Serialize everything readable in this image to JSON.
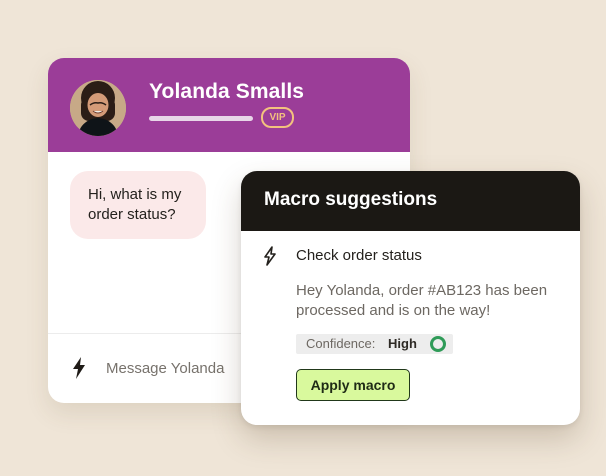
{
  "colors": {
    "background": "#efe5d7",
    "chat_header": "#9b3d98",
    "macro_header": "#1b1814",
    "vip_badge": "#f3c27e",
    "customer_bubble": "#fbe9e9",
    "apply_button": "#d9f99d",
    "confidence_ring": "#2f9b58"
  },
  "chat": {
    "contact_name": "Yolanda Smalls",
    "badge": "VIP",
    "avatar_icon": "user-avatar",
    "customer_message": "Hi, what is my order status?",
    "composer": {
      "icon": "lightning-bolt-icon",
      "placeholder": "Message Yolanda"
    }
  },
  "macro": {
    "title": "Macro suggestions",
    "suggestion": {
      "icon": "lightning-bolt-outline-icon",
      "name": "Check order status",
      "body": "Hey Yolanda, order #AB123 has been processed and is on the way!",
      "confidence_label": "Confidence:",
      "confidence_value": "High",
      "confidence_icon": "confidence-ring-icon"
    },
    "apply_label": "Apply macro"
  }
}
